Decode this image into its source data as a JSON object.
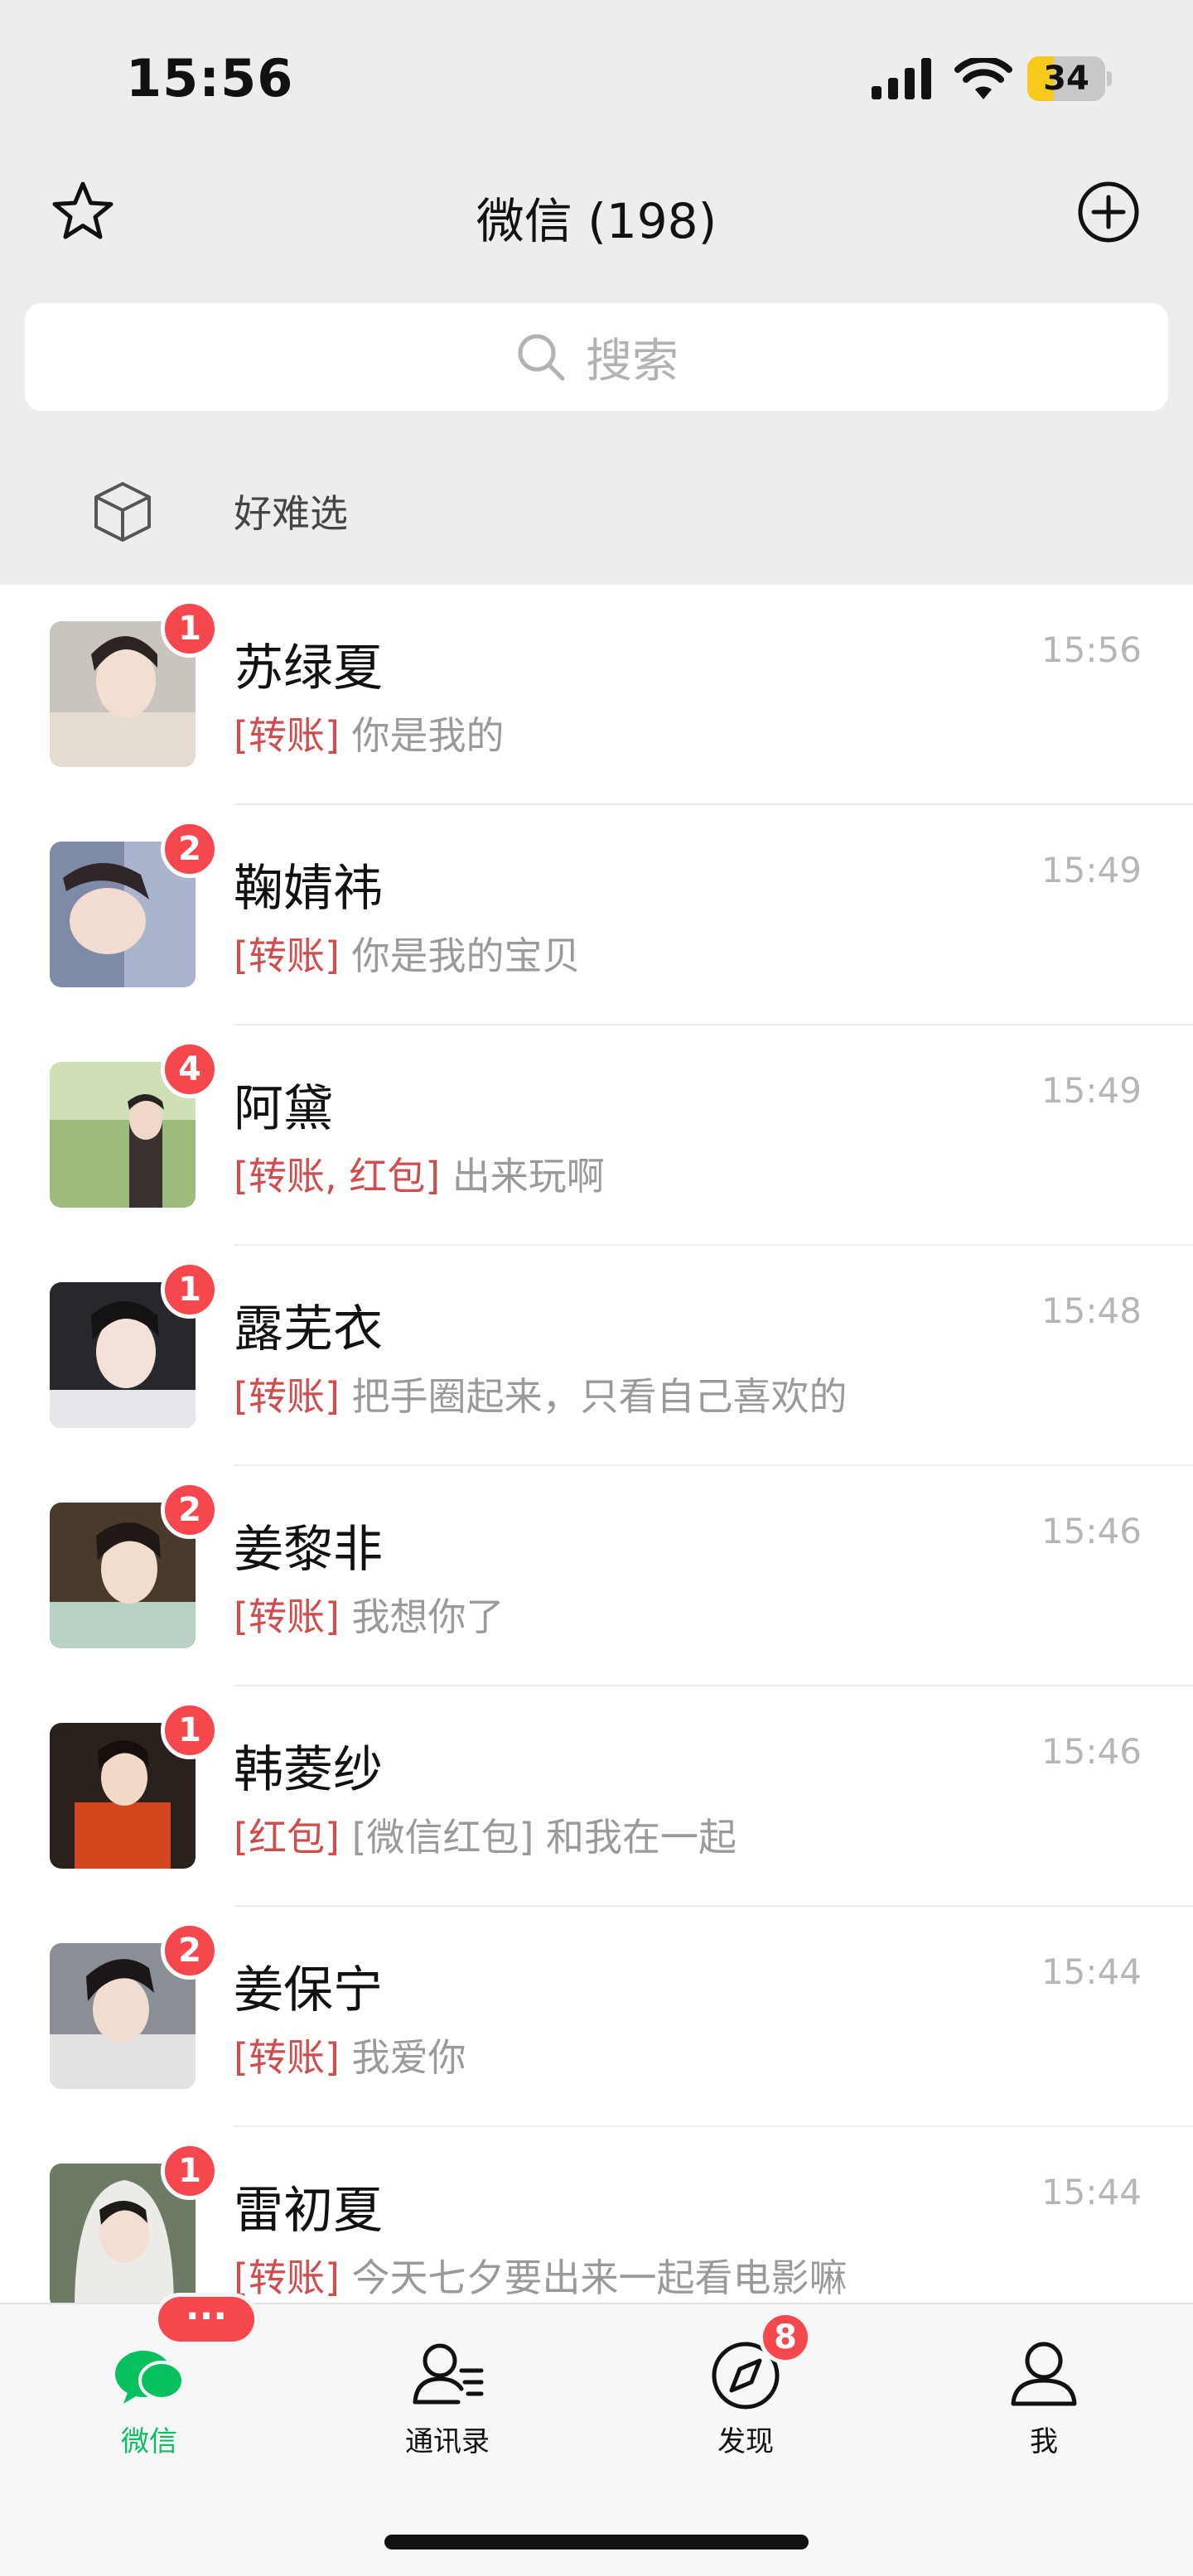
{
  "status_bar": {
    "time": "15:56",
    "battery": "34",
    "battery_level": 0.34
  },
  "header": {
    "title": "微信 (198)"
  },
  "search": {
    "placeholder": "搜索"
  },
  "mini_bar": {
    "label": "好难选"
  },
  "chats": [
    {
      "name": "苏绿夏",
      "time": "15:56",
      "badge": "1",
      "tag": "[转账]",
      "text": "你是我的"
    },
    {
      "name": "鞠婧祎",
      "time": "15:49",
      "badge": "2",
      "tag": "[转账]",
      "text": "你是我的宝贝"
    },
    {
      "name": "阿黛",
      "time": "15:49",
      "badge": "4",
      "tag": "[转账, 红包]",
      "text": "出来玩啊"
    },
    {
      "name": "露芜衣",
      "time": "15:48",
      "badge": "1",
      "tag": "[转账]",
      "text": "把手圈起来，只看自己喜欢的"
    },
    {
      "name": "姜黎非",
      "time": "15:46",
      "badge": "2",
      "tag": "[转账]",
      "text": "我想你了"
    },
    {
      "name": "韩菱纱",
      "time": "15:46",
      "badge": "1",
      "tag": "[红包]",
      "text": "[微信红包] 和我在一起"
    },
    {
      "name": "姜保宁",
      "time": "15:44",
      "badge": "2",
      "tag": "[转账]",
      "text": "我爱你"
    },
    {
      "name": "雷初夏",
      "time": "15:44",
      "badge": "1",
      "tag": "[转账]",
      "text": "今天七夕要出来一起看电影嘛"
    }
  ],
  "tabs": [
    {
      "label": "微信",
      "icon": "chat-bubbles-icon",
      "active": true,
      "badge": "···"
    },
    {
      "label": "通讯录",
      "icon": "contacts-icon",
      "active": false
    },
    {
      "label": "发现",
      "icon": "compass-icon",
      "active": false,
      "badge": "8"
    },
    {
      "label": "我",
      "icon": "person-icon",
      "active": false
    }
  ],
  "colors": {
    "accent": "#07c160",
    "badge": "#f4474e",
    "tag": "#d14c4c"
  }
}
